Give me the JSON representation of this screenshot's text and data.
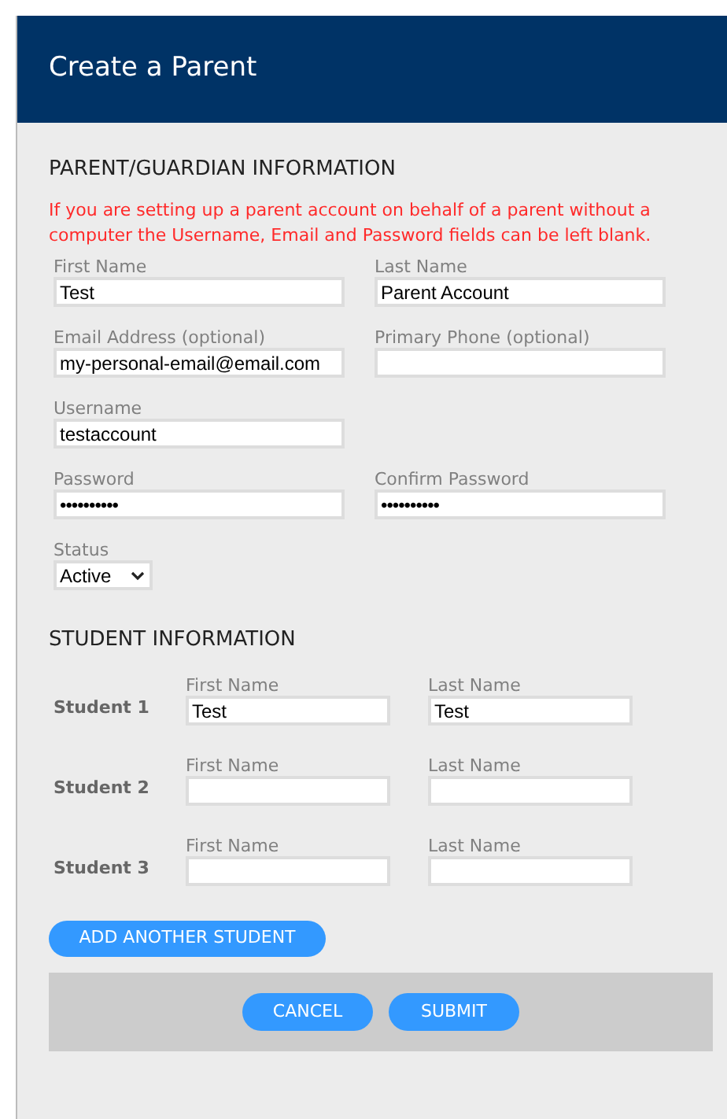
{
  "header": {
    "title": "Create a Parent"
  },
  "parent_section": {
    "heading": "PARENT/GUARDIAN INFORMATION",
    "notice": "If you are setting up a parent account on behalf of a parent without a computer the Username, Email and Password fields can be left blank.",
    "rows": [
      [
        {
          "label": "First Name",
          "kind": "text",
          "value": "Test"
        },
        {
          "label": "Last Name",
          "kind": "text",
          "value": "Parent Account"
        }
      ],
      [
        {
          "label": "Email Address (optional)",
          "kind": "text",
          "value": "my-personal-email@email.com"
        },
        {
          "label": "Primary Phone (optional)",
          "kind": "text"
        }
      ],
      [
        {
          "label": "Username",
          "kind": "text",
          "value": "testaccount"
        }
      ],
      [
        {
          "label": "Password",
          "kind": "password",
          "value": "••••••••••"
        },
        {
          "label": "Confirm Password",
          "kind": "password",
          "value": "••••••••••"
        }
      ],
      [
        {
          "label": "Status",
          "kind": "select",
          "value": "Active"
        }
      ]
    ]
  },
  "student_section": {
    "heading": "STUDENT INFORMATION",
    "students": [
      {
        "label": "Student 1",
        "first_label": "First Name",
        "first_value": "Test",
        "last_label": "Last Name",
        "last_value": "Test"
      },
      {
        "label": "Student 2",
        "first_label": "First Name",
        "last_label": "Last Name"
      },
      {
        "label": "Student 3",
        "first_label": "First Name",
        "last_label": "Last Name"
      }
    ],
    "add_button": "ADD ANOTHER STUDENT"
  },
  "footer": {
    "buttons": [
      "CANCEL",
      "SUBMIT"
    ]
  }
}
